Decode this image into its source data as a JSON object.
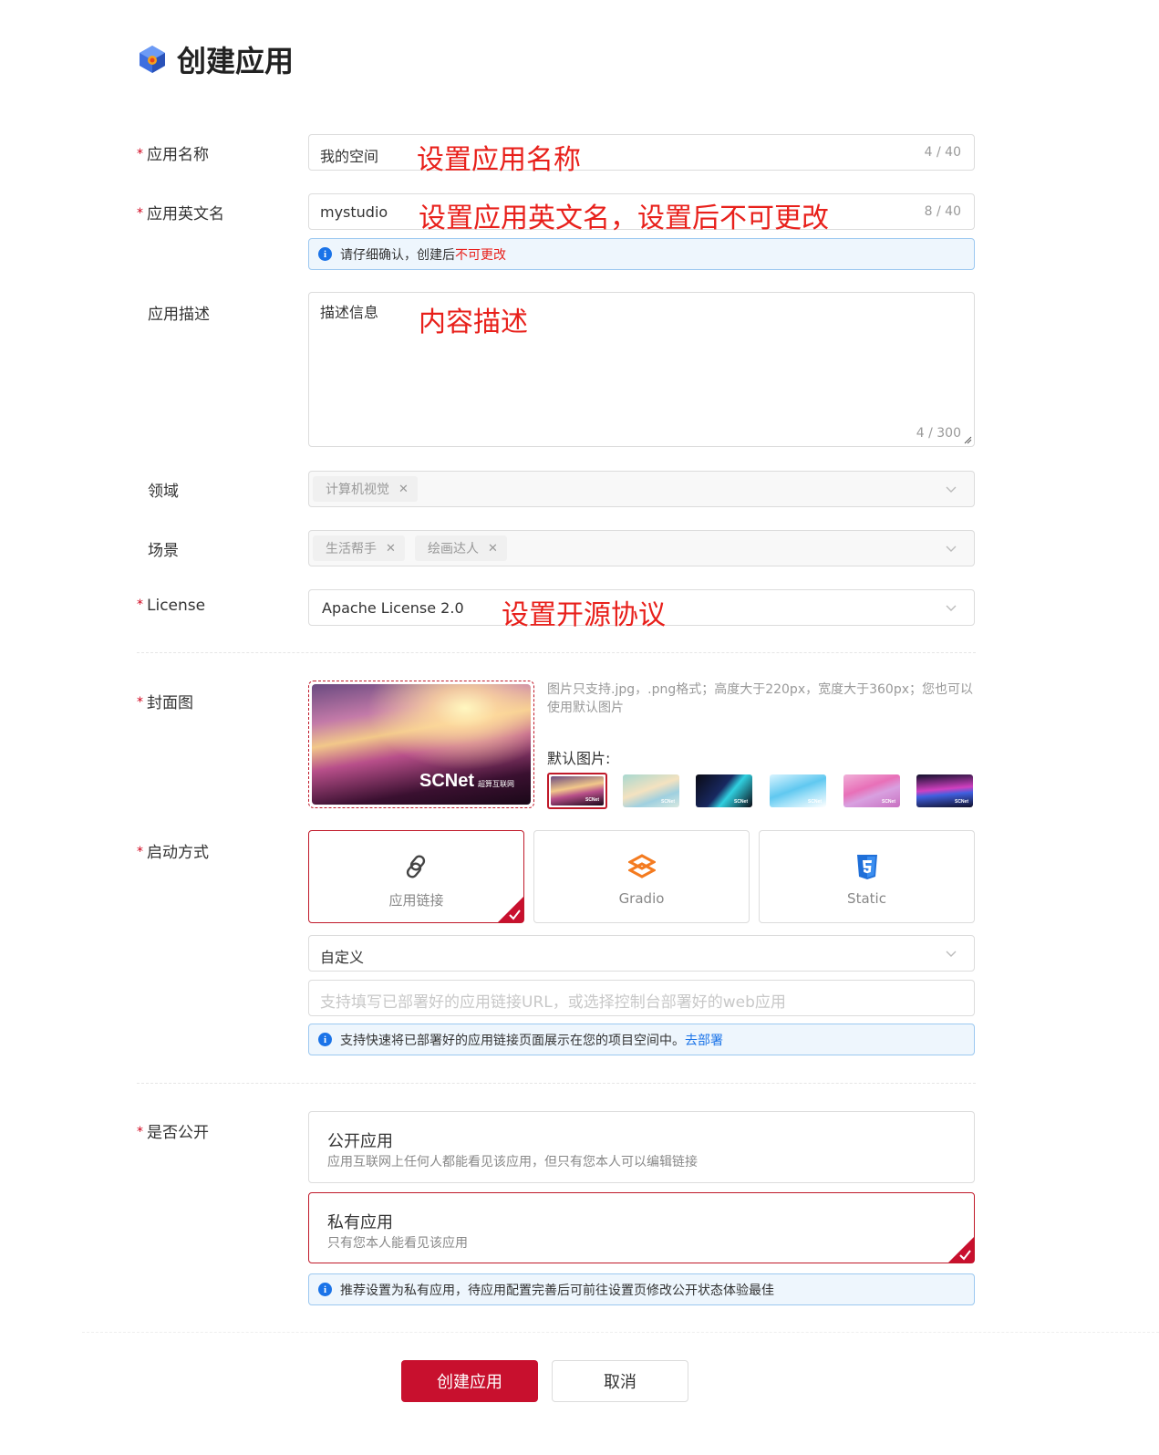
{
  "page": {
    "title": "创建应用"
  },
  "fields": {
    "name": {
      "label": "应用名称",
      "value": "我的空间",
      "count": "4 / 40",
      "note": "设置应用名称"
    },
    "en_name": {
      "label": "应用英文名",
      "value": "mystudio",
      "count": "8 / 40",
      "note": "设置应用英文名，设置后不可更改",
      "info_prefix": "请仔细确认，创建后",
      "info_highlight": "不可更改"
    },
    "desc": {
      "label": "应用描述",
      "value": "描述信息",
      "count": "4 / 300",
      "note": "内容描述"
    },
    "domain": {
      "label": "领域",
      "tags": [
        "计算机视觉"
      ]
    },
    "scene": {
      "label": "场景",
      "tags": [
        "生活帮手",
        "绘画达人"
      ]
    },
    "license": {
      "label": "License",
      "value": "Apache License 2.0",
      "note": "设置开源协议"
    },
    "cover": {
      "label": "封面图",
      "hint": "图片只支持.jpg，.png格式；高度大于220px，宽度大于360px；您也可以使用默认图片",
      "default_label": "默认图片:",
      "brand": "SCNet",
      "brand_sub": "超算互联网"
    },
    "launch": {
      "label": "启动方式",
      "options": [
        {
          "label": "应用链接",
          "icon": "link-icon",
          "selected": true
        },
        {
          "label": "Gradio",
          "icon": "gradio-icon",
          "selected": false
        },
        {
          "label": "Static",
          "icon": "html5-icon",
          "selected": false
        }
      ],
      "mode": "自定义",
      "url_placeholder": "支持填写已部署好的应用链接URL，或选择控制台部署好的web应用",
      "info_text": "支持快速将已部署好的应用链接页面展示在您的项目空间中。",
      "info_link": "去部署"
    },
    "visibility": {
      "label": "是否公开",
      "options": [
        {
          "title": "公开应用",
          "desc": "应用互联网上任何人都能看见该应用，但只有您本人可以编辑链接",
          "selected": false
        },
        {
          "title": "私有应用",
          "desc": "只有您本人能看见该应用",
          "selected": true
        }
      ],
      "info_text": "推荐设置为私有应用，待应用配置完善后可前往设置页修改公开状态体验最佳"
    }
  },
  "actions": {
    "create": "创建应用",
    "cancel": "取消"
  },
  "colors": {
    "primary": "#c8102e",
    "note": "#e8201b",
    "info_bg": "#eef6fd",
    "link": "#1a73e8"
  }
}
